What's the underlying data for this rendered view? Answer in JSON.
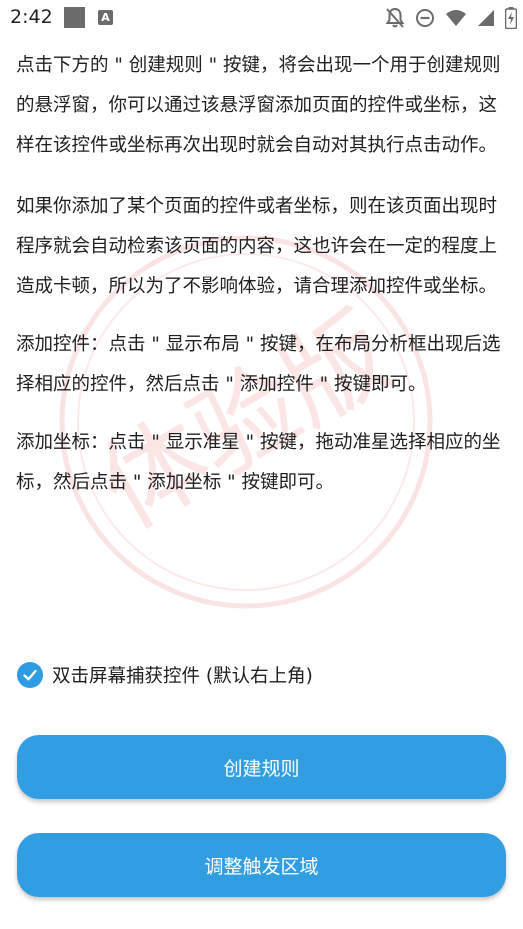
{
  "status_bar": {
    "time": "2:42",
    "notif_a": "A",
    "icons": [
      "square-notification-icon",
      "a-notification-icon",
      "notifications-off-icon",
      "do-not-disturb-icon",
      "wifi-icon",
      "cell-signal-icon",
      "battery-charging-icon"
    ]
  },
  "watermark": {
    "text": "体验版",
    "color": "#e35050"
  },
  "instructions": {
    "paragraph_1": "点击下方的 \" 创建规则 \" 按键，将会出现一个用于创建规则的悬浮窗，你可以通过该悬浮窗添加页面的控件或坐标，这样在该控件或坐标再次出现时就会自动对其执行点击动作。",
    "paragraph_2": "如果你添加了某个页面的控件或者坐标，则在该页面出现时程序就会自动检索该页面的内容，这也许会在一定的程度上造成卡顿，所以为了不影响体验，请合理添加控件或坐标。",
    "paragraph_3": "添加控件：点击 \" 显示布局 \" 按键，在布局分析框出现后选择相应的控件，然后点击 \" 添加控件 \" 按键即可。",
    "paragraph_4": "添加坐标：点击 \" 显示准星 \" 按键，拖动准星选择相应的坐标，然后点击 \" 添加坐标 \" 按键即可。"
  },
  "options": {
    "double_tap_capture": {
      "label": "双击屏幕捕获控件 (默认右上角)",
      "checked": true
    }
  },
  "buttons": {
    "create_rule": "创建规则",
    "adjust_trigger_area": "调整触发区域"
  },
  "colors": {
    "accent": "#329ee2",
    "checkbox": "#2f9be3",
    "text": "#1f1f1f"
  }
}
